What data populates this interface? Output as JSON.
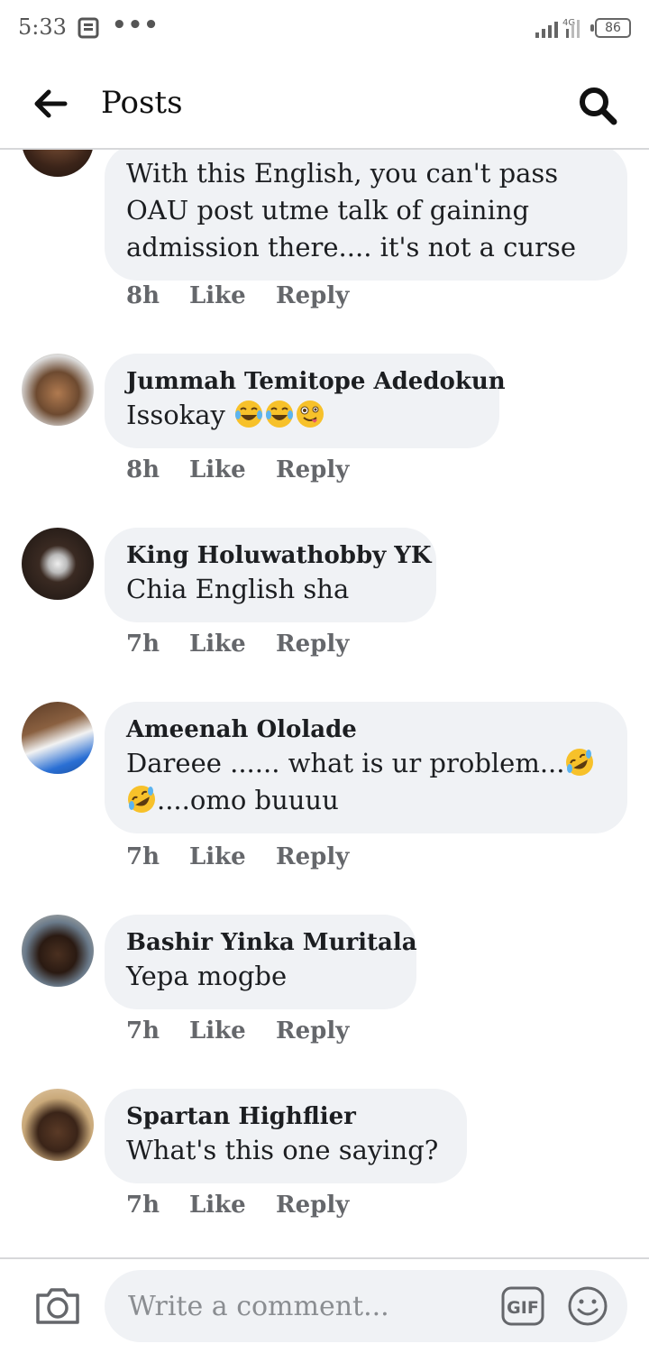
{
  "status_bar": {
    "time": "5:33",
    "network": "4G",
    "battery": "86"
  },
  "header": {
    "title": "Posts"
  },
  "comments": [
    {
      "author": "",
      "text": "With this English, you can't pass OAU post utme talk of gaining admission there.... it's not a curse",
      "time": "8h",
      "like_label": "Like",
      "reply_label": "Reply"
    },
    {
      "author": "Jummah Temitope Adedokun",
      "text": "Issokay",
      "time": "8h",
      "like_label": "Like",
      "reply_label": "Reply",
      "emojis": [
        "tears-of-joy-emoji",
        "tears-of-joy-emoji",
        "zany-face-emoji"
      ]
    },
    {
      "author": "King Holuwathobby YK",
      "text": "Chia English sha",
      "time": "7h",
      "like_label": "Like",
      "reply_label": "Reply"
    },
    {
      "author": "Ameenah Ololade",
      "text_part1": "Dareee ...... what is ur problem...",
      "text_part2": "....omo buuuu",
      "time": "7h",
      "like_label": "Like",
      "reply_label": "Reply",
      "emojis": [
        "rolling-laughing-emoji",
        "rolling-laughing-emoji"
      ]
    },
    {
      "author": "Bashir Yinka Muritala",
      "text": "Yepa mogbe",
      "time": "7h",
      "like_label": "Like",
      "reply_label": "Reply"
    },
    {
      "author": "Spartan Highflier",
      "text": "What's this one saying?",
      "time": "7h",
      "like_label": "Like",
      "reply_label": "Reply"
    }
  ],
  "composer": {
    "placeholder": "Write a comment...",
    "gif_label": "GIF"
  },
  "colors": {
    "bubble": "#f0f2f5",
    "meta_text": "#65676b",
    "divider": "#d7d8da",
    "emoji_face": "#f7c12a"
  }
}
